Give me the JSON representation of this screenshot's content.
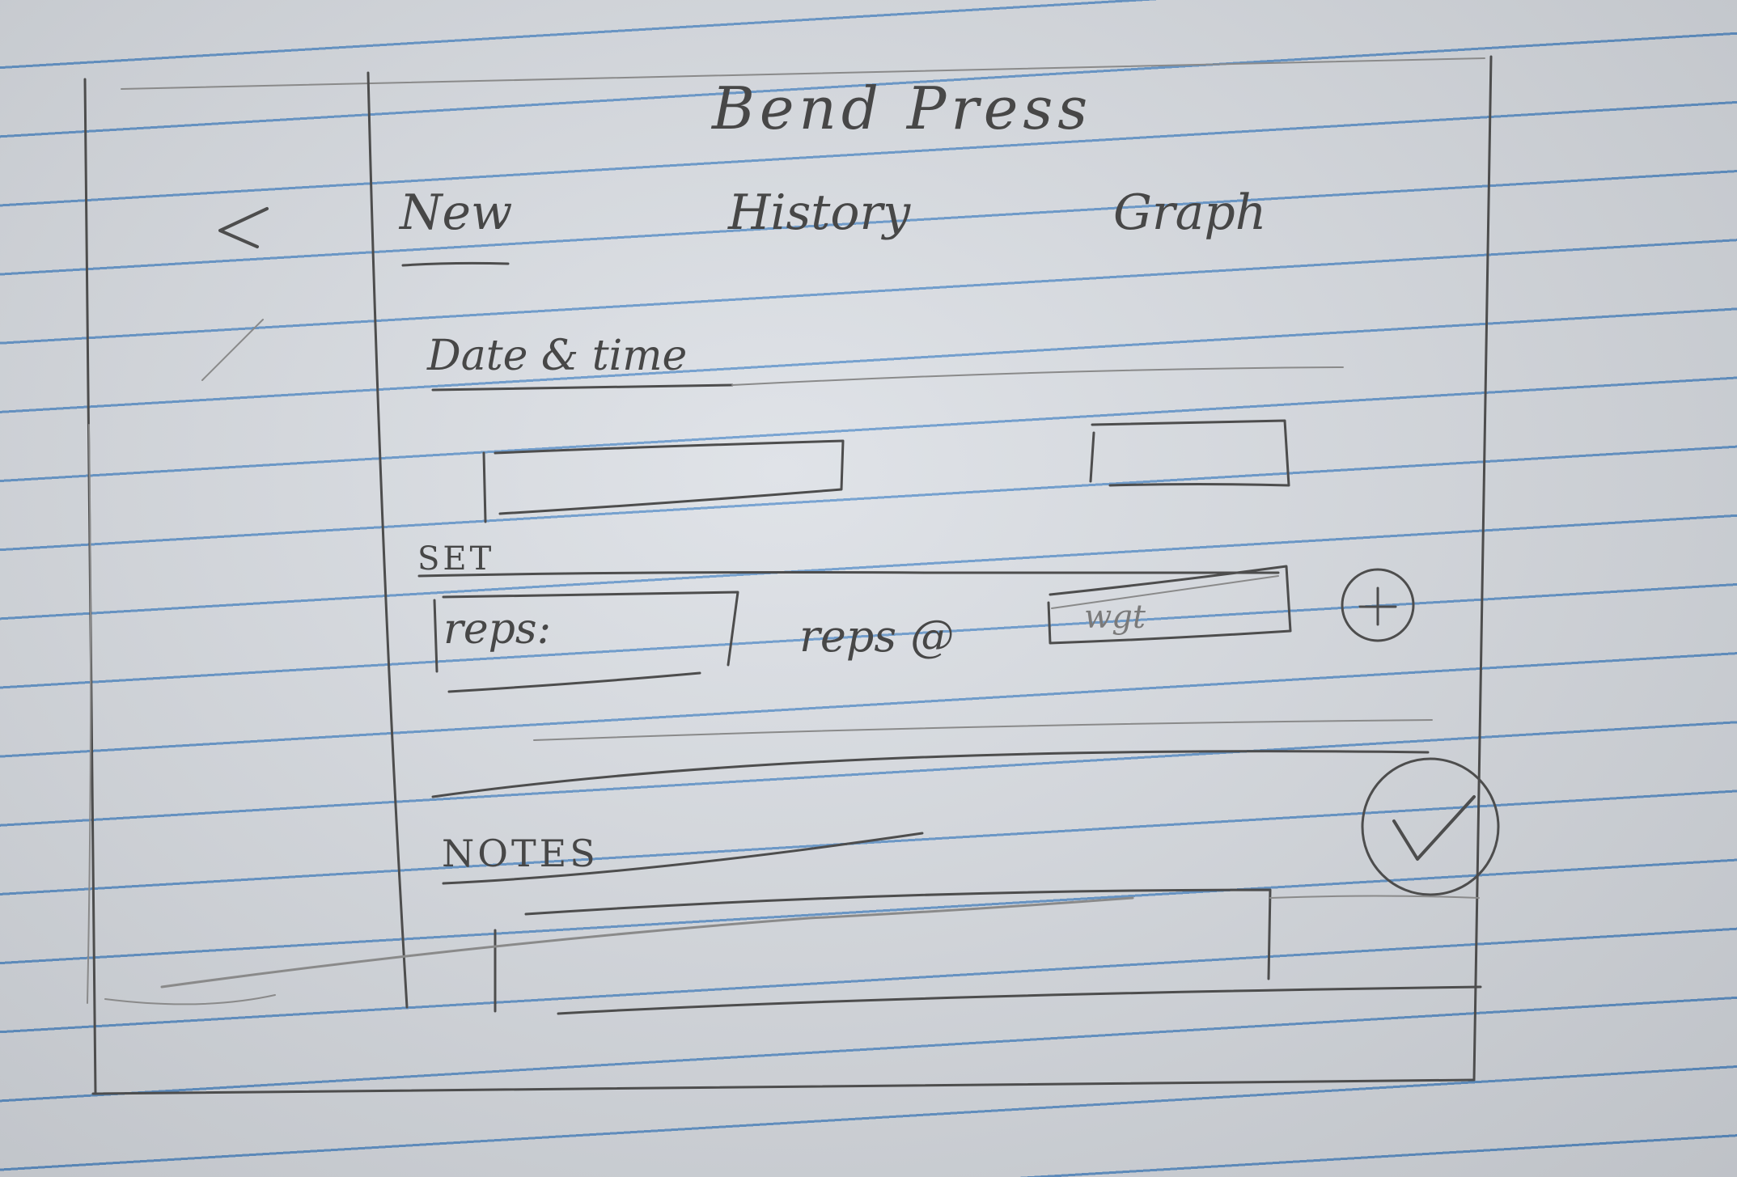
{
  "title": "Bend Press",
  "tabs": [
    {
      "label": "New",
      "selected": true
    },
    {
      "label": "History",
      "selected": false
    },
    {
      "label": "Graph",
      "selected": false
    }
  ],
  "icons": {
    "back": "chevron-left-icon",
    "add": "plus-circle-icon",
    "save": "check-circle-icon"
  },
  "date_time": {
    "label": "Date & time"
  },
  "set": {
    "label": "SET",
    "reps_field": "reps:",
    "reps_suffix": "reps @",
    "weight_field": "wgt"
  },
  "notes": {
    "label": "NOTES"
  }
}
